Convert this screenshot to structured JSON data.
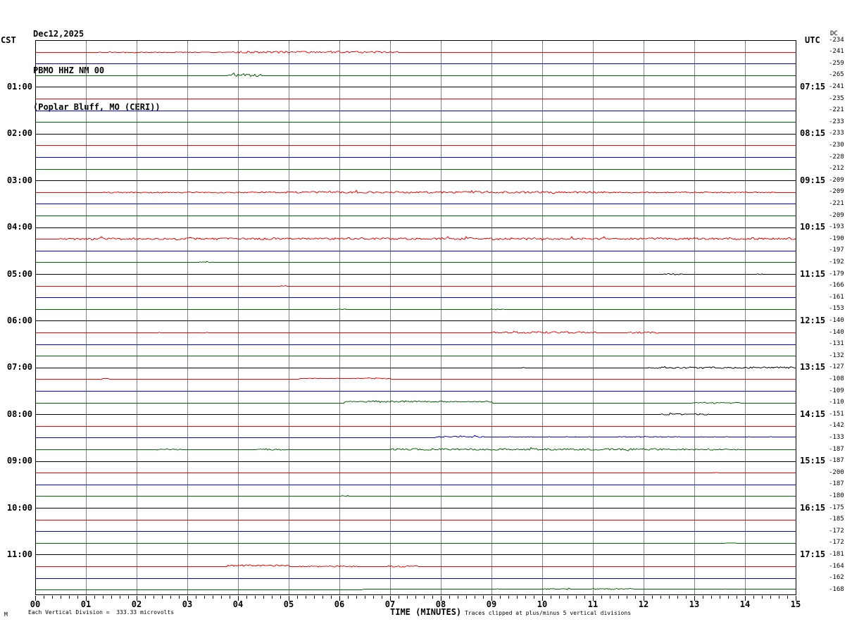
{
  "header": {
    "date": "Dec12,2025",
    "station": "PBMO HHZ NM 00",
    "location": "(Poplar Bluff, MO (CERI))"
  },
  "axes": {
    "left_timezone_label": "CST",
    "right_timezone_label": "UTC",
    "dc_column_label": "DC",
    "x_axis_title": "TIME (MINUTES)",
    "x_ticks": [
      "00",
      "01",
      "02",
      "03",
      "04",
      "05",
      "06",
      "07",
      "08",
      "09",
      "10",
      "11",
      "12",
      "13",
      "14",
      "15"
    ]
  },
  "footer": {
    "watermark": "M",
    "scale_note": "Each Vertical Division =  333.33 microvolts",
    "clip_note": "Traces clipped at plus/minus 5 vertical divisions"
  },
  "left_time_labels": [
    {
      "row": 4,
      "label": "01:00"
    },
    {
      "row": 8,
      "label": "02:00"
    },
    {
      "row": 12,
      "label": "03:00"
    },
    {
      "row": 16,
      "label": "04:00"
    },
    {
      "row": 20,
      "label": "05:00"
    },
    {
      "row": 24,
      "label": "06:00"
    },
    {
      "row": 28,
      "label": "07:00"
    },
    {
      "row": 32,
      "label": "08:00"
    },
    {
      "row": 36,
      "label": "09:00"
    },
    {
      "row": 40,
      "label": "10:00"
    },
    {
      "row": 44,
      "label": "11:00"
    }
  ],
  "right_time_labels": [
    {
      "row": 4,
      "label": "07:15"
    },
    {
      "row": 8,
      "label": "08:15"
    },
    {
      "row": 12,
      "label": "09:15"
    },
    {
      "row": 16,
      "label": "10:15"
    },
    {
      "row": 20,
      "label": "11:15"
    },
    {
      "row": 24,
      "label": "12:15"
    },
    {
      "row": 28,
      "label": "13:15"
    },
    {
      "row": 32,
      "label": "14:15"
    },
    {
      "row": 36,
      "label": "15:15"
    },
    {
      "row": 40,
      "label": "16:15"
    },
    {
      "row": 44,
      "label": "17:15"
    }
  ],
  "chart_data": {
    "type": "line",
    "subtype": "helicorder-seismogram",
    "x_unit": "minutes",
    "x_range": [
      0,
      15
    ],
    "minutes_per_row": 15,
    "rows_per_hour": 4,
    "grid": "vertical lines every 1 minute",
    "microvolts_per_division": "333.33",
    "clip_divisions": 5,
    "colors": {
      "red": "#ff0000",
      "blue": "#0000ee",
      "green": "#006600",
      "black": "#000000",
      "grid": "#808080"
    },
    "rows": [
      {
        "cst": "00:00",
        "color": "black",
        "dc": -234,
        "activity": []
      },
      {
        "cst": "00:15",
        "color": "red",
        "dc": -241,
        "activity": [
          {
            "m0": 1.2,
            "m1": 3.85,
            "amp": 0.7
          },
          {
            "m0": 3.85,
            "m1": 7.15,
            "amp": 1.8
          }
        ]
      },
      {
        "cst": "00:30",
        "color": "blue",
        "dc": -259,
        "activity": []
      },
      {
        "cst": "00:45",
        "color": "green",
        "dc": -265,
        "activity": [
          {
            "m0": 3.8,
            "m1": 4.45,
            "amp": 2.2
          }
        ]
      },
      {
        "cst": "01:00",
        "color": "black",
        "dc": -241,
        "activity": []
      },
      {
        "cst": "01:15",
        "color": "red",
        "dc": -235,
        "activity": []
      },
      {
        "cst": "01:30",
        "color": "blue",
        "dc": -221,
        "activity": []
      },
      {
        "cst": "01:45",
        "color": "green",
        "dc": -233,
        "activity": []
      },
      {
        "cst": "02:00",
        "color": "black",
        "dc": -233,
        "activity": []
      },
      {
        "cst": "02:15",
        "color": "red",
        "dc": -230,
        "activity": []
      },
      {
        "cst": "02:30",
        "color": "blue",
        "dc": -228,
        "activity": []
      },
      {
        "cst": "02:45",
        "color": "green",
        "dc": -212,
        "activity": []
      },
      {
        "cst": "03:00",
        "color": "black",
        "dc": -209,
        "activity": []
      },
      {
        "cst": "03:15",
        "color": "red",
        "dc": -209,
        "activity": [
          {
            "m0": 1.35,
            "m1": 4.4,
            "amp": 1.0
          },
          {
            "m0": 4.4,
            "m1": 11.4,
            "amp": 1.7
          },
          {
            "m0": 11.4,
            "m1": 14.6,
            "amp": 1.0
          }
        ]
      },
      {
        "cst": "03:30",
        "color": "blue",
        "dc": -221,
        "activity": []
      },
      {
        "cst": "03:45",
        "color": "green",
        "dc": -209,
        "activity": []
      },
      {
        "cst": "04:00",
        "color": "black",
        "dc": -193,
        "activity": []
      },
      {
        "cst": "04:15",
        "color": "red",
        "dc": -190,
        "activity": [
          {
            "m0": 0.5,
            "m1": 15,
            "amp": 1.9
          }
        ]
      },
      {
        "cst": "04:30",
        "color": "blue",
        "dc": -197,
        "activity": []
      },
      {
        "cst": "04:45",
        "color": "green",
        "dc": -192,
        "activity": [
          {
            "m0": 3.2,
            "m1": 3.5,
            "amp": 1.4
          }
        ]
      },
      {
        "cst": "05:00",
        "color": "black",
        "dc": -179,
        "activity": [
          {
            "m0": 12.4,
            "m1": 12.85,
            "amp": 1.1
          },
          {
            "m0": 14.25,
            "m1": 14.35,
            "amp": 0.9
          }
        ]
      },
      {
        "cst": "05:15",
        "color": "red",
        "dc": -166,
        "activity": [
          {
            "m0": 4.85,
            "m1": 4.95,
            "amp": 1.4
          }
        ]
      },
      {
        "cst": "05:30",
        "color": "blue",
        "dc": -161,
        "activity": []
      },
      {
        "cst": "05:45",
        "color": "green",
        "dc": -153,
        "activity": [
          {
            "m0": 5.9,
            "m1": 6.15,
            "amp": 0.9
          },
          {
            "m0": 9.0,
            "m1": 9.25,
            "amp": 0.9
          }
        ]
      },
      {
        "cst": "06:00",
        "color": "black",
        "dc": -140,
        "activity": []
      },
      {
        "cst": "06:15",
        "color": "red",
        "dc": -140,
        "activity": [
          {
            "m0": 2.35,
            "m1": 2.45,
            "amp": 0.8
          },
          {
            "m0": 3.3,
            "m1": 3.4,
            "amp": 0.8
          },
          {
            "m0": 9.0,
            "m1": 11.1,
            "amp": 1.6
          },
          {
            "m0": 11.65,
            "m1": 12.35,
            "amp": 1.4
          }
        ]
      },
      {
        "cst": "06:30",
        "color": "blue",
        "dc": -131,
        "activity": []
      },
      {
        "cst": "06:45",
        "color": "green",
        "dc": -132,
        "activity": []
      },
      {
        "cst": "07:00",
        "color": "black",
        "dc": -127,
        "activity": [
          {
            "m0": 9.55,
            "m1": 9.65,
            "amp": 0.7
          },
          {
            "m0": 12.1,
            "m1": 14.95,
            "amp": 1.5
          }
        ]
      },
      {
        "cst": "07:15",
        "color": "red",
        "dc": -108,
        "activity": [
          {
            "m0": 1.3,
            "m1": 1.45,
            "amp": 1.3
          },
          {
            "m0": 5.2,
            "m1": 7.0,
            "amp": 0.4,
            "lift": 1
          },
          {
            "m0": 6.55,
            "m1": 6.95,
            "amp": 1.1
          }
        ]
      },
      {
        "cst": "07:30",
        "color": "blue",
        "dc": -109,
        "activity": []
      },
      {
        "cst": "07:45",
        "color": "green",
        "dc": -110,
        "activity": [
          {
            "m0": 6.1,
            "m1": 9.0,
            "amp": 0.5,
            "lift": 2
          },
          {
            "m0": 6.5,
            "m1": 8.2,
            "amp": 1.4
          },
          {
            "m0": 8.6,
            "m1": 9.0,
            "amp": 1.1
          },
          {
            "m0": 12.95,
            "m1": 13.9,
            "amp": 1.1
          }
        ]
      },
      {
        "cst": "08:00",
        "color": "black",
        "dc": -151,
        "activity": [
          {
            "m0": 12.35,
            "m1": 13.3,
            "amp": 1.3
          }
        ]
      },
      {
        "cst": "08:15",
        "color": "red",
        "dc": -142,
        "activity": []
      },
      {
        "cst": "08:30",
        "color": "blue",
        "dc": -133,
        "activity": [
          {
            "m0": 7.9,
            "m1": 15,
            "amp": 0.3,
            "lift": 1
          },
          {
            "m0": 7.95,
            "m1": 8.85,
            "amp": 1.1
          },
          {
            "m0": 9.3,
            "m1": 9.85,
            "amp": 0.5
          },
          {
            "m0": 11.5,
            "m1": 12.7,
            "amp": 0.7
          }
        ]
      },
      {
        "cst": "08:45",
        "color": "green",
        "dc": -187,
        "activity": [
          {
            "m0": 2.4,
            "m1": 2.95,
            "amp": 1.2
          },
          {
            "m0": 4.35,
            "m1": 5.0,
            "amp": 1.1
          },
          {
            "m0": 7.0,
            "m1": 12.5,
            "amp": 1.7
          },
          {
            "m0": 12.6,
            "m1": 13.9,
            "amp": 0.9
          }
        ]
      },
      {
        "cst": "09:00",
        "color": "black",
        "dc": -187,
        "activity": []
      },
      {
        "cst": "09:15",
        "color": "red",
        "dc": -200,
        "activity": [
          {
            "m0": 13.3,
            "m1": 13.45,
            "amp": 0.8
          }
        ]
      },
      {
        "cst": "09:30",
        "color": "blue",
        "dc": -187,
        "activity": []
      },
      {
        "cst": "09:45",
        "color": "green",
        "dc": -180,
        "activity": [
          {
            "m0": 6.05,
            "m1": 6.2,
            "amp": 0.8
          }
        ]
      },
      {
        "cst": "10:00",
        "color": "black",
        "dc": -175,
        "activity": []
      },
      {
        "cst": "10:15",
        "color": "red",
        "dc": -185,
        "activity": []
      },
      {
        "cst": "10:30",
        "color": "blue",
        "dc": -172,
        "activity": []
      },
      {
        "cst": "10:45",
        "color": "green",
        "dc": -172,
        "activity": [
          {
            "m0": 13.6,
            "m1": 13.85,
            "amp": 0.8
          }
        ]
      },
      {
        "cst": "11:00",
        "color": "black",
        "dc": -181,
        "activity": []
      },
      {
        "cst": "11:15",
        "color": "red",
        "dc": -164,
        "activity": [
          {
            "m0": 3.8,
            "m1": 5.0,
            "amp": 1.5,
            "lift": 1
          },
          {
            "m0": 5.2,
            "m1": 6.35,
            "amp": 1.1
          },
          {
            "m0": 6.95,
            "m1": 7.6,
            "amp": 1.3
          }
        ]
      },
      {
        "cst": "11:30",
        "color": "blue",
        "dc": -162,
        "activity": []
      },
      {
        "cst": "11:45",
        "color": "green",
        "dc": -168,
        "activity": [
          {
            "m0": 6.45,
            "m1": 15,
            "amp": 0.2,
            "lift": 1
          },
          {
            "m0": 10.05,
            "m1": 10.55,
            "amp": 0.9
          },
          {
            "m0": 11.0,
            "m1": 11.85,
            "amp": 1.1
          }
        ]
      }
    ]
  }
}
